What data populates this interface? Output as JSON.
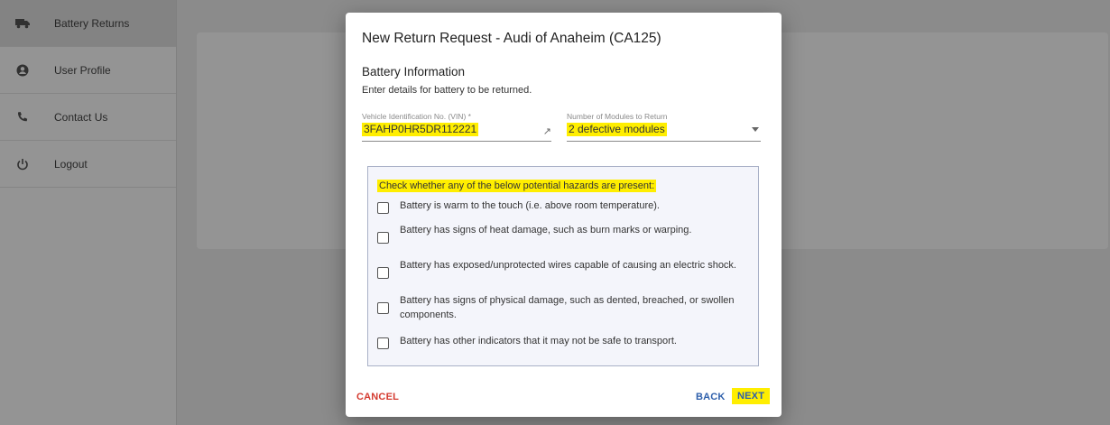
{
  "sidebar": {
    "items": [
      {
        "label": "Battery Returns",
        "icon": "truck-icon",
        "active": true
      },
      {
        "label": "User Profile",
        "icon": "account-icon",
        "active": false
      },
      {
        "label": "Contact Us",
        "icon": "phone-icon",
        "active": false
      },
      {
        "label": "Logout",
        "icon": "power-icon",
        "active": false
      }
    ]
  },
  "dialog": {
    "title": "New Return Request - Audi of Anaheim (CA125)",
    "section_title": "Battery Information",
    "section_subtitle": "Enter details for battery to be returned.",
    "vin_field": {
      "label": "Vehicle Identification No. (VIN) *",
      "value": "3FAHP0HR5DR112221"
    },
    "modules_field": {
      "label": "Number of Modules to Return",
      "value": "2 defective modules"
    },
    "hazards": {
      "prompt": "Check whether any of the below potential hazards are present:",
      "items": [
        "Battery is warm to the touch (i.e. above room temperature).",
        "Battery has signs of heat damage, such as burn marks or warping.",
        "Battery has exposed/unprotected wires capable of causing an electric shock.",
        "Battery has signs of physical damage, such as dented, breached, or swollen components.",
        "Battery has other indicators that it may not be safe to transport."
      ]
    },
    "buttons": {
      "cancel": "CANCEL",
      "back": "BACK",
      "next": "NEXT"
    }
  },
  "colors": {
    "highlight": "#ffee00",
    "cancel": "#d43a2f",
    "primary": "#2e5fab"
  }
}
